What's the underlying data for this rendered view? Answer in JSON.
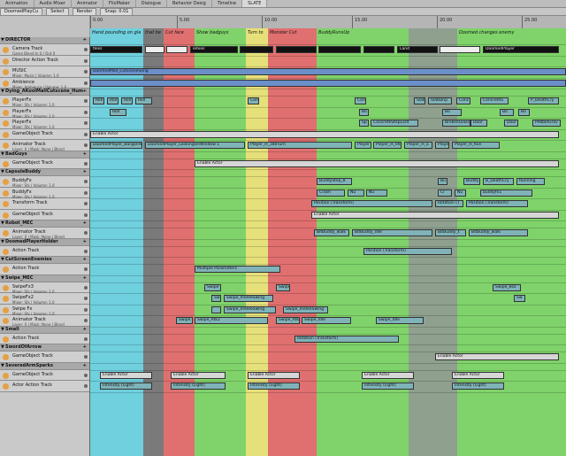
{
  "tabs": [
    "Animation",
    "Audio Mixer",
    "Animator",
    "FlixMaker",
    "Dialogue",
    "Behavior Desig",
    "Timeline",
    "SLATE"
  ],
  "active_tab": 7,
  "toolbar": {
    "scene": "DoomedPlayCu",
    "select": "Select",
    "render": "Render",
    "snap": "Snap: 0.01"
  },
  "ruler": {
    "ticks": [
      "0.00",
      "5.00",
      "10.00",
      "15.00",
      "20.00",
      "25.00"
    ]
  },
  "markers": [
    {
      "label": "Hand pounding on gla",
      "color": "#6fd0de"
    },
    {
      "label": "that be",
      "color": "#7a7a7a"
    },
    {
      "label": "Cut face",
      "color": "#e07070"
    },
    {
      "label": "Show badguys",
      "color": "#7fd36a"
    },
    {
      "label": "Turn to",
      "color": "#e6e07a"
    },
    {
      "label": "Monster Cut",
      "color": "#e07070"
    },
    {
      "label": "BuddyRunsUp",
      "color": "#7fd36a"
    },
    {
      "label": "",
      "color": "#8fa08f"
    },
    {
      "label": "Doomed changes enemy",
      "color": "#7fd36a"
    }
  ],
  "rows": [
    {
      "kind": "group",
      "label": "DIRECTOR"
    },
    {
      "kind": "track",
      "name": "Camera Track",
      "sub": "Game Blend In 0 / Out 0",
      "icon": "#e4a042"
    },
    {
      "kind": "track",
      "name": "Director Action Track",
      "sub": "",
      "icon": "#e4a042"
    },
    {
      "kind": "track",
      "name": "MUSIC",
      "sub": "Mixer: Music | Volume: 1.0",
      "icon": "#e4a042"
    },
    {
      "kind": "track",
      "name": "Ambience",
      "sub": "Mixer: Ambience | Volume: 1.0",
      "icon": "#e4a042"
    },
    {
      "kind": "group",
      "label": "Dying_AKoolMallCutscene_Hum"
    },
    {
      "kind": "track",
      "name": "PlayerFx",
      "sub": "Mixer: Sfx | Volume: 1.0",
      "icon": "#e4a042"
    },
    {
      "kind": "track",
      "name": "PlayerFx",
      "sub": "Mixer: Sfx | Volume: 1.0",
      "icon": "#e4a042"
    },
    {
      "kind": "track",
      "name": "PlayerFx",
      "sub": "Mixer: Sfx | Volume: 1.0",
      "icon": "#e4a042"
    },
    {
      "kind": "track",
      "name": "GameObject Track",
      "sub": "",
      "icon": "#e4a042"
    },
    {
      "kind": "track",
      "name": "Animator Track",
      "sub": "Layer: 0 | Mask: None | Blend",
      "icon": "#e4a042"
    },
    {
      "kind": "group",
      "label": "BadGuys"
    },
    {
      "kind": "track",
      "name": "GameObject Track",
      "sub": "",
      "icon": "#e4a042"
    },
    {
      "kind": "group",
      "label": "CapsuleBuddy"
    },
    {
      "kind": "track",
      "name": "BuddyFx",
      "sub": "Mixer: Sfx | Volume: 1.0",
      "icon": "#e4a042"
    },
    {
      "kind": "track",
      "name": "BuddyFx",
      "sub": "Mixer: Sfx | Volume: 1.0",
      "icon": "#e4a042"
    },
    {
      "kind": "track",
      "name": "Transform Track",
      "sub": "",
      "icon": "#e4a042"
    },
    {
      "kind": "track",
      "name": "GameObject Track",
      "sub": "",
      "icon": "#e4a042"
    },
    {
      "kind": "group",
      "label": "Robot_MEC"
    },
    {
      "kind": "track",
      "name": "Animator Track",
      "sub": "Layer: 0 | Mask: None | Blend",
      "icon": "#e4a042"
    },
    {
      "kind": "group",
      "label": "DoomedPlayerHolder"
    },
    {
      "kind": "track",
      "name": "Action Track",
      "sub": "",
      "icon": "#e4a042"
    },
    {
      "kind": "group",
      "label": "CutScreenEnemies"
    },
    {
      "kind": "track",
      "name": "Action Track",
      "sub": "",
      "icon": "#e4a042"
    },
    {
      "kind": "group",
      "label": "Swipe_MEC"
    },
    {
      "kind": "track",
      "name": "SwipeFx3",
      "sub": "Mixer: Sfx | Volume: 1.0",
      "icon": "#e4a042"
    },
    {
      "kind": "track",
      "name": "SwipeFx2",
      "sub": "Mixer: Sfx | Volume: 1.0",
      "icon": "#e4a042"
    },
    {
      "kind": "track",
      "name": "Swipe Fx",
      "sub": "Mixer: Sfx | Volume: 1.0",
      "icon": "#e4a042"
    },
    {
      "kind": "track",
      "name": "Animator Track",
      "sub": "Layer: 0 | Mask: None | Blend",
      "icon": "#e4a042"
    },
    {
      "kind": "group",
      "label": "Small"
    },
    {
      "kind": "track",
      "name": "Action Track",
      "sub": "",
      "icon": "#e4a042"
    },
    {
      "kind": "group",
      "label": "SwordOfArrow"
    },
    {
      "kind": "track",
      "name": "GameObject Track",
      "sub": "",
      "icon": "#e4a042"
    },
    {
      "kind": "group",
      "label": "SeveredArmSparks"
    },
    {
      "kind": "track",
      "name": "GameObject Track",
      "sub": "",
      "icon": "#e4a042"
    },
    {
      "kind": "track",
      "name": "Actor Action Track",
      "sub": "",
      "icon": "#e4a042"
    }
  ],
  "clips": [
    {
      "row": 1,
      "t0": 0.0,
      "t1": 0.11,
      "label": "tless",
      "style": "black"
    },
    {
      "row": 1,
      "t0": 0.115,
      "t1": 0.155,
      "label": "",
      "style": "white"
    },
    {
      "row": 1,
      "t0": 0.16,
      "t1": 0.205,
      "label": "",
      "style": "white"
    },
    {
      "row": 1,
      "t0": 0.21,
      "t1": 0.31,
      "label": "emies",
      "style": "black"
    },
    {
      "row": 1,
      "t0": 0.315,
      "t1": 0.385,
      "label": "",
      "style": "black"
    },
    {
      "row": 1,
      "t0": 0.39,
      "t1": 0.475,
      "label": "",
      "style": "black"
    },
    {
      "row": 1,
      "t0": 0.48,
      "t1": 0.57,
      "label": "",
      "style": "black"
    },
    {
      "row": 1,
      "t0": 0.575,
      "t1": 0.64,
      "label": "",
      "style": "black"
    },
    {
      "row": 1,
      "t0": 0.645,
      "t1": 0.73,
      "label": "Land",
      "style": "black"
    },
    {
      "row": 1,
      "t0": 0.735,
      "t1": 0.82,
      "label": "",
      "style": "white"
    },
    {
      "row": 1,
      "t0": 0.825,
      "t1": 0.985,
      "label": "DoomedPlayer",
      "style": "black"
    },
    {
      "row": 3,
      "t0": 0.0,
      "t1": 1.0,
      "label": "DoomedMall_CutsceneSong",
      "style": "blue"
    },
    {
      "row": 4,
      "t0": 0.0,
      "t1": 1.0,
      "label": "",
      "style": "blue"
    },
    {
      "row": 6,
      "t0": 0.005,
      "t1": 0.03,
      "label": "Roll",
      "style": "teal"
    },
    {
      "row": 6,
      "t0": 0.035,
      "t1": 0.06,
      "label": "Roll",
      "style": "teal"
    },
    {
      "row": 6,
      "t0": 0.065,
      "t1": 0.09,
      "label": "Roll",
      "style": "teal"
    },
    {
      "row": 6,
      "t0": 0.095,
      "t1": 0.13,
      "label": "Roll",
      "style": "teal"
    },
    {
      "row": 6,
      "t0": 0.33,
      "t1": 0.355,
      "label": "Conc",
      "style": "teal"
    },
    {
      "row": 6,
      "t0": 0.555,
      "t1": 0.58,
      "label": "Conc",
      "style": "teal"
    },
    {
      "row": 6,
      "t0": 0.68,
      "t1": 0.705,
      "label": "Slab",
      "style": "teal"
    },
    {
      "row": 6,
      "t0": 0.71,
      "t1": 0.76,
      "label": "SlabDrip",
      "style": "teal"
    },
    {
      "row": 6,
      "t0": 0.77,
      "t1": 0.8,
      "label": "Conc",
      "style": "teal"
    },
    {
      "row": 6,
      "t0": 0.82,
      "t1": 0.88,
      "label": "ConcreteS",
      "style": "teal"
    },
    {
      "row": 6,
      "t0": 0.92,
      "t1": 0.985,
      "label": "P_DeathCry",
      "style": "teal"
    },
    {
      "row": 7,
      "t0": 0.04,
      "t1": 0.075,
      "label": "Roll",
      "style": "teal"
    },
    {
      "row": 7,
      "t0": 0.565,
      "t1": 0.585,
      "label": "Bo",
      "style": "teal"
    },
    {
      "row": 7,
      "t0": 0.74,
      "t1": 0.78,
      "label": "Bo",
      "style": "teal"
    },
    {
      "row": 7,
      "t0": 0.86,
      "t1": 0.89,
      "label": "Bo",
      "style": "teal"
    },
    {
      "row": 7,
      "t0": 0.9,
      "t1": 0.925,
      "label": "Bo",
      "style": "teal"
    },
    {
      "row": 8,
      "t0": 0.565,
      "t1": 0.585,
      "label": "Sp",
      "style": "teal"
    },
    {
      "row": 8,
      "t0": 0.59,
      "t1": 0.69,
      "label": "ConcreteStepLord",
      "style": "teal"
    },
    {
      "row": 8,
      "t0": 0.74,
      "t1": 0.8,
      "label": "BrokenGlass",
      "style": "teal"
    },
    {
      "row": 8,
      "t0": 0.8,
      "t1": 0.835,
      "label": "Door",
      "style": "teal"
    },
    {
      "row": 8,
      "t0": 0.87,
      "t1": 0.9,
      "label": "Door",
      "style": "teal"
    },
    {
      "row": 8,
      "t0": 0.93,
      "t1": 0.99,
      "label": "PebbleGrav",
      "style": "teal"
    },
    {
      "row": 9,
      "t0": 0.0,
      "t1": 0.985,
      "label": "Enable Actor",
      "style": "grey"
    },
    {
      "row": 10,
      "t0": 0.0,
      "t1": 0.11,
      "label": "DoomedPlayer_BangOnWindow",
      "style": "teal"
    },
    {
      "row": 10,
      "t0": 0.115,
      "t1": 0.325,
      "label": "DoomedPlayer_LookingOnWindow 1",
      "style": "teal"
    },
    {
      "row": 10,
      "t0": 0.33,
      "t1": 0.55,
      "label": "Player_H_180Turn",
      "style": "teal"
    },
    {
      "row": 10,
      "t0": 0.555,
      "t1": 0.59,
      "label": "Player",
      "style": "teal"
    },
    {
      "row": 10,
      "t0": 0.595,
      "t1": 0.655,
      "label": "Player_H_Idle",
      "style": "teal"
    },
    {
      "row": 10,
      "t0": 0.66,
      "t1": 0.72,
      "label": "Player_H_a",
      "style": "teal"
    },
    {
      "row": 10,
      "t0": 0.725,
      "t1": 0.755,
      "label": "Player",
      "style": "teal"
    },
    {
      "row": 10,
      "t0": 0.76,
      "t1": 0.86,
      "label": "Player_H_Run",
      "style": "teal"
    },
    {
      "row": 12,
      "t0": 0.22,
      "t1": 0.985,
      "label": "Enable Actor",
      "style": "grey"
    },
    {
      "row": 14,
      "t0": 0.475,
      "t1": 0.55,
      "label": "BuddyStep_8",
      "style": "teal"
    },
    {
      "row": 14,
      "t0": 0.73,
      "t1": 0.75,
      "label": "Bu",
      "style": "teal"
    },
    {
      "row": 14,
      "t0": 0.785,
      "t1": 0.82,
      "label": "Buddy",
      "style": "teal"
    },
    {
      "row": 14,
      "t0": 0.825,
      "t1": 0.89,
      "label": "B_DeathCry",
      "style": "teal"
    },
    {
      "row": 14,
      "t0": 0.895,
      "t1": 0.955,
      "label": "Running",
      "style": "teal"
    },
    {
      "row": 15,
      "t0": 0.475,
      "t1": 0.535,
      "label": "Crash",
      "style": "teal"
    },
    {
      "row": 15,
      "t0": 0.54,
      "t1": 0.575,
      "label": "Nu",
      "style": "teal"
    },
    {
      "row": 15,
      "t0": 0.58,
      "t1": 0.625,
      "label": "Nu",
      "style": "teal"
    },
    {
      "row": 15,
      "t0": 0.73,
      "t1": 0.76,
      "label": "Cr",
      "style": "teal"
    },
    {
      "row": 15,
      "t0": 0.765,
      "t1": 0.79,
      "label": "Nu",
      "style": "teal"
    },
    {
      "row": 15,
      "t0": 0.82,
      "t1": 0.93,
      "label": "buddyfx1",
      "style": "teal"
    },
    {
      "row": 16,
      "t0": 0.465,
      "t1": 0.72,
      "label": "Position (Transform)",
      "style": "teal"
    },
    {
      "row": 16,
      "t0": 0.725,
      "t1": 0.785,
      "label": "Rotation (T",
      "style": "teal"
    },
    {
      "row": 16,
      "t0": 0.79,
      "t1": 0.92,
      "label": "Position (Transform)",
      "style": "teal"
    },
    {
      "row": 17,
      "t0": 0.465,
      "t1": 0.985,
      "label": "Enable Actor",
      "style": "grey"
    },
    {
      "row": 19,
      "t0": 0.47,
      "t1": 0.545,
      "label": "BitBuddy_walk",
      "style": "teal"
    },
    {
      "row": 19,
      "t0": 0.55,
      "t1": 0.72,
      "label": "BitBuddy_Idle",
      "style": "teal"
    },
    {
      "row": 19,
      "t0": 0.725,
      "t1": 0.79,
      "label": "BitBuddy_t",
      "style": "teal"
    },
    {
      "row": 19,
      "t0": 0.795,
      "t1": 0.92,
      "label": "BitBuddy_walk",
      "style": "teal"
    },
    {
      "row": 21,
      "t0": 0.575,
      "t1": 0.76,
      "label": "Position (Transform)",
      "style": "teal"
    },
    {
      "row": 23,
      "t0": 0.22,
      "t1": 0.4,
      "label": "Multiple Parameters",
      "style": "teal"
    },
    {
      "row": 25,
      "t0": 0.24,
      "t1": 0.275,
      "label": "Swipe",
      "style": "teal"
    },
    {
      "row": 25,
      "t0": 0.39,
      "t1": 0.42,
      "label": "Swipe",
      "style": "teal"
    },
    {
      "row": 25,
      "t0": 0.845,
      "t1": 0.905,
      "label": "Swipe_Bsz",
      "style": "teal"
    },
    {
      "row": 26,
      "t0": 0.255,
      "t1": 0.275,
      "label": "Sw",
      "style": "teal"
    },
    {
      "row": 26,
      "t0": 0.28,
      "t1": 0.385,
      "label": "Swipe_meleeSwing",
      "style": "teal"
    },
    {
      "row": 26,
      "t0": 0.89,
      "t1": 0.915,
      "label": "Sw",
      "style": "teal"
    },
    {
      "row": 27,
      "t0": 0.255,
      "t1": 0.275,
      "label": "",
      "style": "teal"
    },
    {
      "row": 27,
      "t0": 0.28,
      "t1": 0.39,
      "label": "Swipe_meleeSwing",
      "style": "teal"
    },
    {
      "row": 27,
      "t0": 0.405,
      "t1": 0.5,
      "label": "Swipe_meleeSwing",
      "style": "teal"
    },
    {
      "row": 28,
      "t0": 0.18,
      "t1": 0.215,
      "label": "Swipe",
      "style": "teal"
    },
    {
      "row": 28,
      "t0": 0.22,
      "t1": 0.375,
      "label": "Swipe_Atk2",
      "style": "teal"
    },
    {
      "row": 28,
      "t0": 0.39,
      "t1": 0.44,
      "label": "Swipe_Atk3",
      "style": "teal"
    },
    {
      "row": 28,
      "t0": 0.445,
      "t1": 0.55,
      "label": "Swipe_Idle",
      "style": "teal"
    },
    {
      "row": 28,
      "t0": 0.6,
      "t1": 0.7,
      "label": "Swipe_Idle",
      "style": "teal"
    },
    {
      "row": 30,
      "t0": 0.43,
      "t1": 0.65,
      "label": "Rotation (Transform)",
      "style": "teal"
    },
    {
      "row": 32,
      "t0": 0.725,
      "t1": 0.985,
      "label": "Enable Actor",
      "style": "grey"
    },
    {
      "row": 34,
      "t0": 0.02,
      "t1": 0.13,
      "label": "Enable Actor",
      "style": "grey"
    },
    {
      "row": 34,
      "t0": 0.17,
      "t1": 0.285,
      "label": "Enable Actor",
      "style": "grey"
    },
    {
      "row": 34,
      "t0": 0.33,
      "t1": 0.44,
      "label": "Enable Actor",
      "style": "grey"
    },
    {
      "row": 34,
      "t0": 0.57,
      "t1": 0.68,
      "label": "Enable Actor",
      "style": "grey"
    },
    {
      "row": 34,
      "t0": 0.76,
      "t1": 0.87,
      "label": "Enable Actor",
      "style": "grey"
    },
    {
      "row": 35,
      "t0": 0.02,
      "t1": 0.13,
      "label": "Intensity (Light)",
      "style": "teal"
    },
    {
      "row": 35,
      "t0": 0.17,
      "t1": 0.285,
      "label": "Intensity (Light)",
      "style": "teal"
    },
    {
      "row": 35,
      "t0": 0.33,
      "t1": 0.44,
      "label": "Intensity (Light)",
      "style": "teal"
    },
    {
      "row": 35,
      "t0": 0.57,
      "t1": 0.68,
      "label": "Intensity (Light)",
      "style": "teal"
    },
    {
      "row": 35,
      "t0": 0.76,
      "t1": 0.87,
      "label": "Intensity (Light)",
      "style": "teal"
    }
  ]
}
